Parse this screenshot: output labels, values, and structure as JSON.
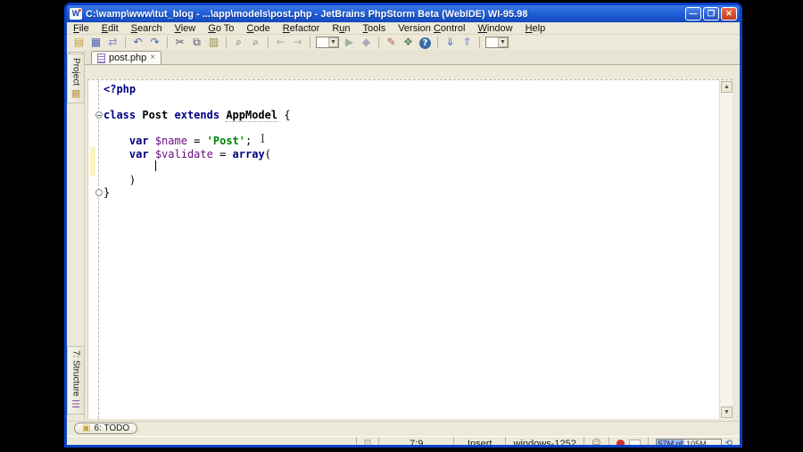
{
  "window": {
    "title": "C:\\wamp\\www\\tut_blog - ...\\app\\models\\post.php - JetBrains PhpStorm Beta (WebIDE) WI-95.98",
    "controls": {
      "minimize": "—",
      "maximize": "❐",
      "close": "✕"
    }
  },
  "menu": [
    {
      "label": "File",
      "u": 0
    },
    {
      "label": "Edit",
      "u": 0
    },
    {
      "label": "Search",
      "u": 0
    },
    {
      "label": "View",
      "u": 0
    },
    {
      "label": "Go To",
      "u": 0
    },
    {
      "label": "Code",
      "u": 0
    },
    {
      "label": "Refactor",
      "u": 0
    },
    {
      "label": "Run",
      "u": 1
    },
    {
      "label": "Tools",
      "u": 0
    },
    {
      "label": "Version Control",
      "u": 8
    },
    {
      "label": "Window",
      "u": 0
    },
    {
      "label": "Help",
      "u": 0
    }
  ],
  "toolbar": [
    [
      {
        "name": "open",
        "glyph": "▤",
        "color": "#c89b3c"
      },
      {
        "name": "save",
        "glyph": "▦",
        "color": "#4a63b4"
      },
      {
        "name": "synchronize",
        "glyph": "⇄",
        "color": "#8a8ac4"
      }
    ],
    [
      {
        "name": "undo",
        "glyph": "↶",
        "color": "#4a63b4"
      },
      {
        "name": "redo",
        "glyph": "↷",
        "color": "#4a63b4"
      }
    ],
    [
      {
        "name": "cut",
        "glyph": "✂",
        "color": "#555566"
      },
      {
        "name": "copy",
        "glyph": "⧉",
        "color": "#555566"
      },
      {
        "name": "paste",
        "glyph": "▥",
        "color": "#9a8a4a"
      }
    ],
    [
      {
        "name": "find",
        "glyph": "⌕",
        "color": "#345a7a"
      },
      {
        "name": "replace",
        "glyph": "⌕",
        "color": "#7a345a"
      }
    ],
    [
      {
        "name": "back",
        "glyph": "←",
        "color": "#b0ab98"
      },
      {
        "name": "forward",
        "glyph": "→",
        "color": "#b0ab98"
      }
    ],
    [
      {
        "name": "run-config",
        "glyph": "▼",
        "color": "#444444",
        "combo": true
      },
      {
        "name": "run",
        "glyph": "▶",
        "color": "#9fb39f"
      },
      {
        "name": "debug",
        "glyph": "◆",
        "color": "#a9a9b9"
      }
    ],
    [
      {
        "name": "settings",
        "glyph": "✎",
        "color": "#b06040"
      },
      {
        "name": "export-layout",
        "glyph": "❖",
        "color": "#5a8a5a"
      },
      {
        "name": "help",
        "glyph": "?",
        "color": "#ffffff",
        "circle": true
      }
    ],
    [
      {
        "name": "update-project",
        "glyph": "⇓",
        "color": "#3a6ec8"
      },
      {
        "name": "commit-changes",
        "glyph": "⇑",
        "color": "#6a8ac8"
      }
    ],
    [
      {
        "name": "more",
        "glyph": "▼",
        "color": "#444444",
        "combo": true
      }
    ]
  ],
  "tab": {
    "label": "post.php",
    "close": "×"
  },
  "tool_windows": {
    "project_label": "Project",
    "structure_label": "7: Structure",
    "todo_label": "6: TODO"
  },
  "editor": {
    "lines": [
      [
        {
          "t": "tag",
          "v": "<?php"
        }
      ],
      [],
      [
        {
          "t": "kw",
          "v": "class"
        },
        {
          "t": "pl",
          "v": " "
        },
        {
          "t": "cls",
          "v": "Post"
        },
        {
          "t": "pl",
          "v": " "
        },
        {
          "t": "kw",
          "v": "extends"
        },
        {
          "t": "pl",
          "v": " "
        },
        {
          "t": "clsref",
          "v": "AppModel"
        },
        {
          "t": "pl",
          "v": " {"
        }
      ],
      [],
      [
        {
          "t": "pl",
          "v": "    "
        },
        {
          "t": "kw",
          "v": "var"
        },
        {
          "t": "pl",
          "v": " "
        },
        {
          "t": "fld",
          "v": "$name"
        },
        {
          "t": "pl",
          "v": " = "
        },
        {
          "t": "str",
          "v": "'Post'"
        },
        {
          "t": "pl",
          "v": ";"
        }
      ],
      [
        {
          "t": "pl",
          "v": "    "
        },
        {
          "t": "kw",
          "v": "var"
        },
        {
          "t": "pl",
          "v": " "
        },
        {
          "t": "fld",
          "v": "$validate"
        },
        {
          "t": "pl",
          "v": " = "
        },
        {
          "t": "kw",
          "v": "array"
        },
        {
          "t": "pl",
          "v": "("
        }
      ],
      [
        {
          "t": "pl",
          "v": "        "
        },
        {
          "t": "caret",
          "v": ""
        }
      ],
      [
        {
          "t": "pl",
          "v": "    )"
        }
      ],
      [
        {
          "t": "pl",
          "v": "}"
        }
      ]
    ],
    "fold_lines": [
      3,
      9
    ]
  },
  "status": {
    "position": "7:9",
    "mode": "Insert",
    "encoding": "windows-1252",
    "memory_used": "57M of",
    "memory_total": "105M"
  },
  "colors": {
    "keyword": "#000080",
    "string": "#008000",
    "field": "#660e7a",
    "title_accent": "#2160d8",
    "error_indicator": "#d23427"
  }
}
